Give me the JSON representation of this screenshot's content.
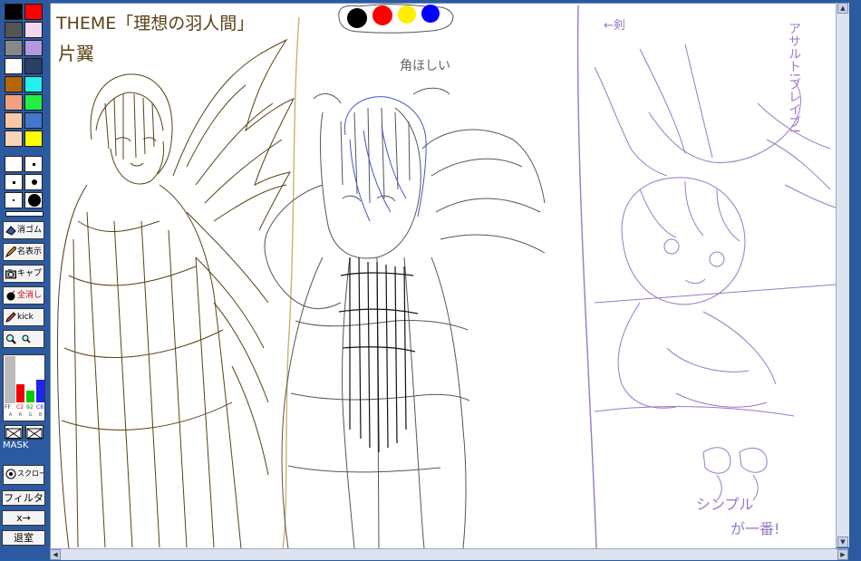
{
  "palette": {
    "colors": [
      "#000000",
      "#ff0000",
      "#555555",
      "#f4d7ef",
      "#888888",
      "#b099dd",
      "#ffffff",
      "#2a3f66",
      "#b4640a",
      "#22f0ee",
      "#f0a080",
      "#22ee44",
      "#f8c8a8",
      "#4477cc",
      "#f8d4b8",
      "#ffff00"
    ]
  },
  "rgb_bars": {
    "axis_label": "FF",
    "channel_letters": [
      "A",
      "R",
      "G",
      "B"
    ],
    "values": {
      "r": "C2",
      "g": "92",
      "b": "C8"
    },
    "levels": {
      "r": 0.62,
      "g": 0.4,
      "b": 0.78
    }
  },
  "tools": {
    "eraser": "消ゴム",
    "show_names": "名表示",
    "capture": "キャプ",
    "clear_all": "全消し",
    "kick": "kick",
    "scroll": "スクロール"
  },
  "mask_label": "MASK",
  "bottom_buttons": {
    "filter": "フィルタ",
    "x_arrow": "x→",
    "exit": "退室"
  },
  "canvas_palette": {
    "dots": [
      "#000000",
      "#ff0000",
      "#ffff00",
      "#0000ff"
    ]
  },
  "canvas_text": {
    "theme": "THEME「理想の羽人間」",
    "left_note": "片翼",
    "mid_note": "角ほしい",
    "right_top": "←剣",
    "right_vertical": "アサルト!ブレイブ!",
    "right_bottom_1": "シンプル",
    "right_bottom_2": "が一番!"
  },
  "colors": {
    "frame": "#2c5aa0",
    "ink_brown": "#5a4214",
    "ink_gray": "#555555",
    "ink_blue": "#4455cc",
    "ink_purple": "#9a78c8"
  }
}
